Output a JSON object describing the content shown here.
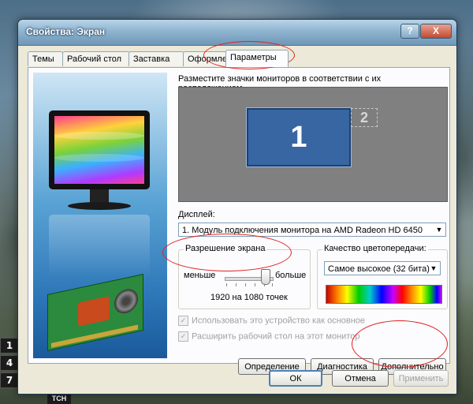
{
  "window": {
    "title": "Свойства: Экран",
    "help_label": "?",
    "close_label": "X"
  },
  "tabs": [
    {
      "label": "Темы"
    },
    {
      "label": "Рабочий стол"
    },
    {
      "label": "Заставка"
    },
    {
      "label": "Оформление"
    },
    {
      "label": "Параметры",
      "active": true
    }
  ],
  "settings": {
    "arrange_hint": "Разместите значки мониторов в соответствии с их расположением.",
    "monitors": [
      "1",
      "2"
    ],
    "display_label": "Дисплей:",
    "display_value": "1. Модуль подключения монитора на AMD Radeon HD 6450",
    "resolution": {
      "group_title": "Разрешение экрана",
      "less": "меньше",
      "more": "больше",
      "value": "1920 на 1080 точек",
      "slider_level": 0.85
    },
    "color_quality": {
      "group_title": "Качество цветопередачи:",
      "value": "Самое высокое (32 бита)"
    },
    "checkboxes": [
      {
        "label": "Использовать это устройство как основное",
        "checked": true
      },
      {
        "label": "Расширить рабочий стол на этот монитор",
        "checked": true
      }
    ],
    "buttons": {
      "identify": "Определение",
      "diagnostics": "Диагностика",
      "advanced": "Дополнительно"
    }
  },
  "footer": {
    "ok": "ОК",
    "cancel": "Отмена",
    "apply": "Применить"
  },
  "desktop_keys": [
    "1",
    "4",
    "7"
  ],
  "bottom_tab": "ТСН",
  "colors": {
    "accent": "#3866a3",
    "annotation": "#e02020",
    "window_bg": "#ece9d8"
  }
}
